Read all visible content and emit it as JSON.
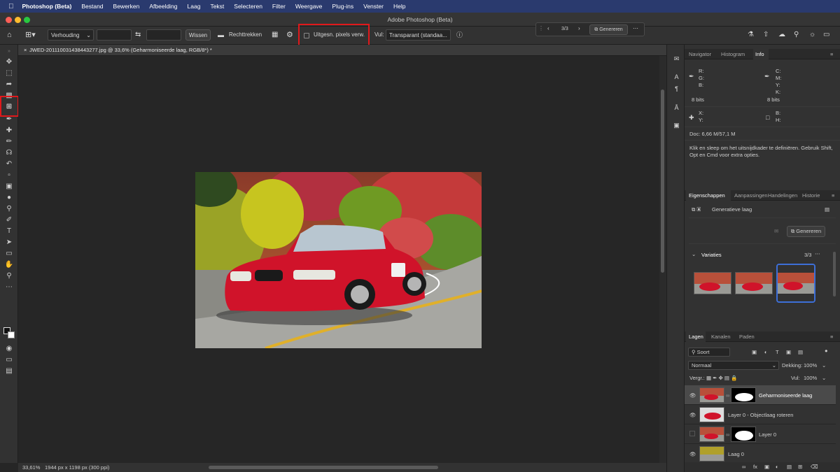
{
  "menubar": {
    "app": "Photoshop (Beta)",
    "items": [
      "Bestand",
      "Bewerken",
      "Afbeelding",
      "Laag",
      "Tekst",
      "Selecteren",
      "Filter",
      "Weergave",
      "Plug-ins",
      "Venster",
      "Help"
    ]
  },
  "window": {
    "title": "Adobe Photoshop (Beta)"
  },
  "options": {
    "ratio_select": "Verhouding",
    "wissen": "Wissen",
    "rechttrekken": "Rechttrekken",
    "delete_pixels": "Uitgesn. pixels verw.",
    "vul_label": "Vul:",
    "vul_value": "Transparant (standaa..."
  },
  "context_bar": {
    "count": "3/3",
    "generate": "Genereren"
  },
  "document": {
    "tab_title": "JWED-201110031438443277.jpg @ 33,6% (Geharmoniseerde laag, RGB/8*) *",
    "zoom": "33,61%",
    "info": "1944 px x 1198 px (300 ppi)"
  },
  "info_panel": {
    "tabs": [
      "Navigator",
      "Histogram",
      "Info"
    ],
    "active_tab": "Info",
    "rgb": [
      "R:",
      "G:",
      "B:"
    ],
    "cmyk": [
      "C:",
      "M:",
      "Y:",
      "K:"
    ],
    "bits_left": "8 bits",
    "bits_right": "8 bits",
    "xy": [
      "X:",
      "Y:"
    ],
    "bh": [
      "B:",
      "H:"
    ],
    "doc": "Doc: 6,66 M/57,1 M",
    "hint": "Klik en sleep om het uitsnijdkader te definiëren. Gebruik Shift, Opt en Cmd voor extra opties."
  },
  "props_panel": {
    "tabs": [
      "Eigenschappen",
      "Aanpassingen",
      "Handelingen",
      "Historie"
    ],
    "active_tab": "Eigenschappen",
    "layer_type": "Generatieve laag",
    "generate": "Genereren",
    "variations_label": "Variaties",
    "variations_count": "3/3"
  },
  "layers_panel": {
    "tabs": [
      "Lagen",
      "Kanalen",
      "Paden"
    ],
    "active_tab": "Lagen",
    "filter": "Soort",
    "blend": "Normaal",
    "opacity_label": "Dekking:",
    "opacity": "100%",
    "lock_label": "Vergr.:",
    "fill_label": "Vul:",
    "fill": "100%",
    "layers": [
      {
        "name": "Geharmoniseerde laag",
        "visible": true,
        "selected": true,
        "mask": true
      },
      {
        "name": "Layer 0 - Objectlaag roteren",
        "visible": true,
        "selected": false,
        "mask": false
      },
      {
        "name": "Layer 0",
        "visible": false,
        "selected": false,
        "mask": true
      },
      {
        "name": "Laag 0",
        "visible": true,
        "selected": false,
        "mask": false
      }
    ]
  },
  "colors": {
    "highlight": "#e0181b",
    "menubar": "#2a3a6e",
    "selected_variation": "#3d6fd8"
  }
}
